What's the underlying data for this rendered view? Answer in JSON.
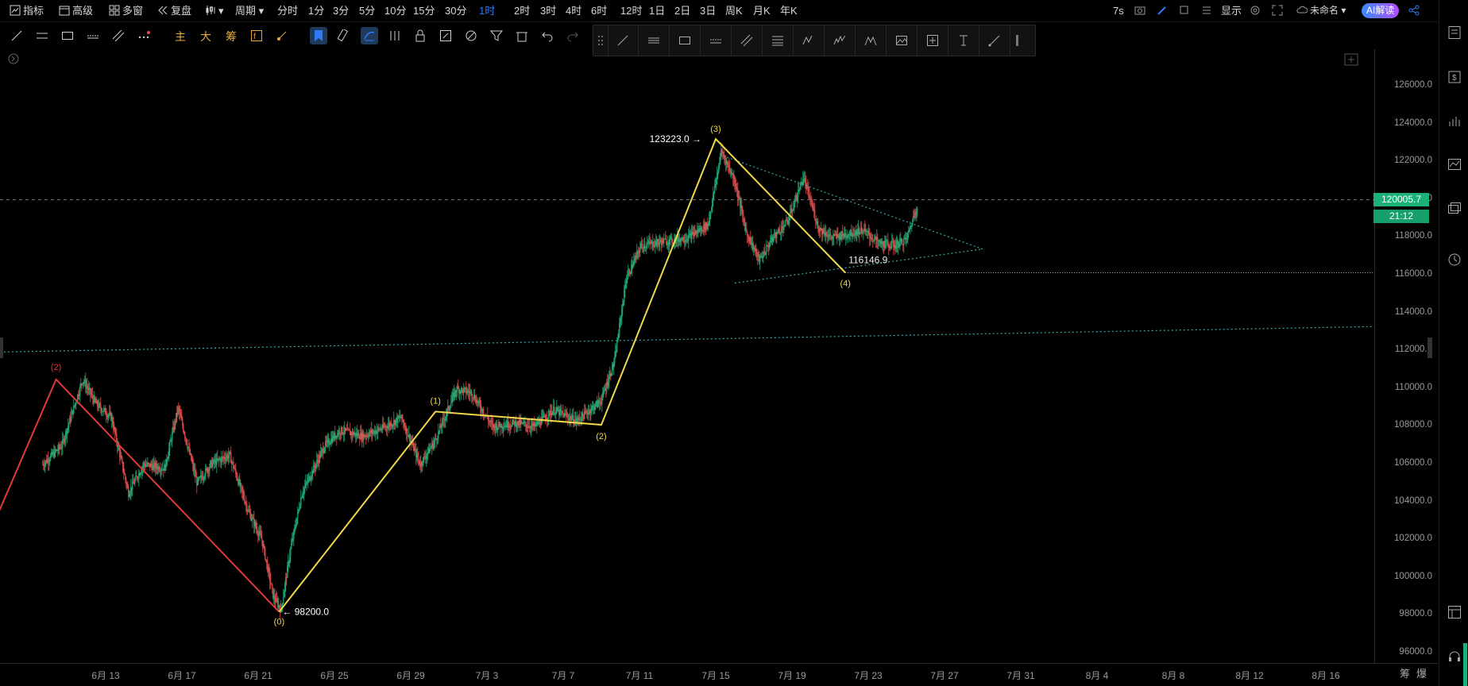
{
  "topbar": {
    "indicators": "指标",
    "advanced": "高级",
    "multi_window": "多窗",
    "replay": "复盘",
    "period": "周期",
    "periods": [
      "分时",
      "1分",
      "3分",
      "5分",
      "10分",
      "15分",
      "30分",
      "1时",
      "2时",
      "3时",
      "4时",
      "6时",
      "12时",
      "1日",
      "2日",
      "3日",
      "周K",
      "月K",
      "年K"
    ],
    "active_period": "1时",
    "countdown": "7s",
    "display": "显示",
    "unnamed": "未命名",
    "ai_button": "AI解读"
  },
  "toolbar": {
    "main": "主",
    "big": "大",
    "chips": "筹"
  },
  "axis": {
    "y_ticks": [
      "126000.0",
      "124000.0",
      "122000.0",
      "120000.0",
      "118000.0",
      "116000.0",
      "114000.0",
      "112000.0",
      "110000.0",
      "108000.0",
      "106000.0",
      "104000.0",
      "102000.0",
      "100000.0",
      "98000.0",
      "96000.0"
    ],
    "x_ticks": [
      "6月 13",
      "6月 17",
      "6月 21",
      "6月 25",
      "6月 29",
      "7月 3",
      "7月 7",
      "7月 11",
      "7月 15",
      "7月 19",
      "7月 23",
      "7月 27",
      "7月 31",
      "8月 4",
      "8月 8",
      "8月 12",
      "8月 16"
    ],
    "bottom_right": [
      "筹",
      "爆"
    ]
  },
  "price": {
    "current": "120005.7",
    "countdown": "21:12"
  },
  "annotations": {
    "high_label": "123223.0",
    "low_label": "98200.0",
    "pivot_label": "116146.9",
    "red_wave": [
      "(2)"
    ],
    "yellow_wave": [
      "(0)",
      "(1)",
      "(2)",
      "(3)",
      "(4)"
    ]
  },
  "colors": {
    "up": "#1bb27a",
    "down": "#e64c4c",
    "wave_red": "#e03a3a",
    "wave_yellow": "#f0d84a",
    "trend_teal": "#3aa6a6",
    "active_blue": "#2f7bf6",
    "badge_green": "#1bb27a"
  },
  "chart_data": {
    "type": "candlestick",
    "series": "hourly price",
    "ylim": [
      96000,
      126000
    ],
    "x_range": [
      "6月 10",
      "8月 18"
    ],
    "high": 123223.0,
    "low": 98200.0,
    "last": 120005.7,
    "wave_points": [
      {
        "label": "(2)",
        "date": "6月 12",
        "price": 110500,
        "color": "red"
      },
      {
        "label": "(0)",
        "date": "6月 23",
        "price": 98200,
        "color": "yellow"
      },
      {
        "label": "(1)",
        "date": "7月 1",
        "price": 108800,
        "color": "yellow"
      },
      {
        "label": "(2)",
        "date": "7月 9",
        "price": 108100,
        "color": "yellow"
      },
      {
        "label": "(3)",
        "date": "7月 14",
        "price": 123223,
        "color": "yellow"
      },
      {
        "label": "(4)",
        "date": "7月 22",
        "price": 116146.9,
        "color": "yellow"
      }
    ]
  }
}
